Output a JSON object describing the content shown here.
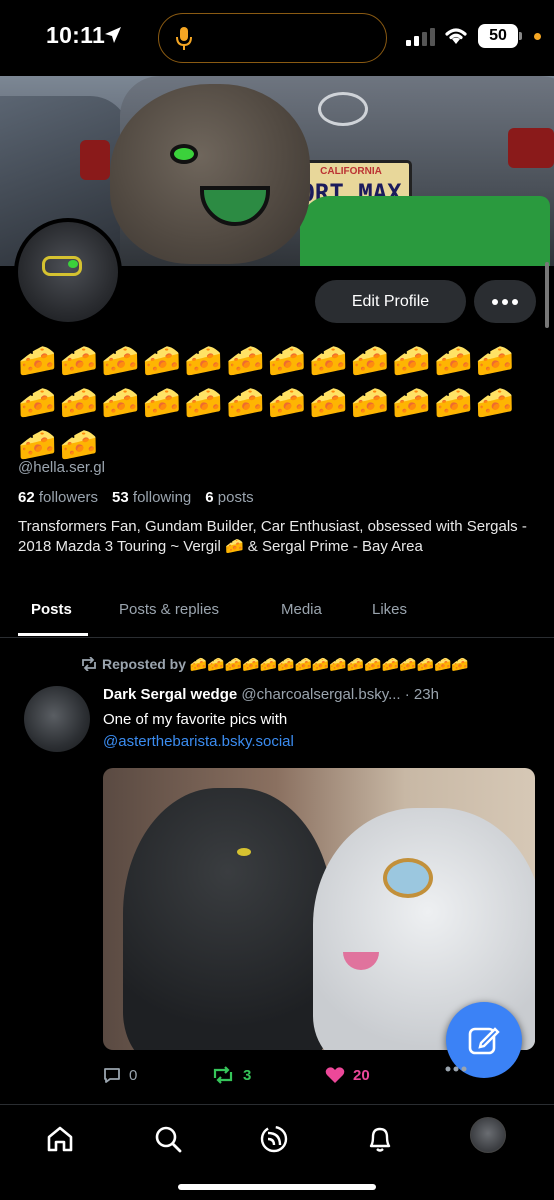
{
  "status_bar": {
    "time": "10:11",
    "battery": "50",
    "icons": [
      "location-arrow-icon",
      "microphone-icon",
      "cellular-signal-icon",
      "wifi-icon",
      "battery-icon"
    ]
  },
  "banner": {
    "plate_state": "CALIFORNIA",
    "plate_text": "ORT MAX"
  },
  "profile": {
    "display_name": "🧀🧀🧀🧀🧀🧀🧀🧀🧀🧀🧀🧀🧀🧀🧀🧀🧀🧀🧀🧀🧀🧀🧀🧀🧀🧀",
    "handle": "@hella.ser.gl",
    "followers_count": "62",
    "followers_label": "followers",
    "following_count": "53",
    "following_label": "following",
    "posts_count": "6",
    "posts_label": "posts",
    "bio": "Transformers Fan, Gundam Builder, Car Enthusiast, obsessed with Sergals - 2018 Mazda 3 Touring ~ Vergil 🧀 & Sergal Prime - Bay Area",
    "edit_label": "Edit Profile"
  },
  "tabs": [
    {
      "label": "Posts",
      "active": true
    },
    {
      "label": "Posts & replies",
      "active": false
    },
    {
      "label": "Media",
      "active": false
    },
    {
      "label": "Likes",
      "active": false
    }
  ],
  "post": {
    "repost_label": "Reposted by 🧀🧀🧀🧀🧀🧀🧀🧀🧀🧀🧀🧀🧀🧀🧀🧀",
    "author": "Dark Sergal wedge",
    "author_handle": "@charcoalsergal.bsky...",
    "time": "· 23h",
    "text": "One of my favorite pics with",
    "link": "@asterthebarista.bsky.social",
    "reply_count": "0",
    "repost_count": "3",
    "like_count": "20"
  },
  "colors": {
    "accent_blue": "#3b82f6",
    "link_blue": "#3b8cf0",
    "repost_green": "#36c55a",
    "like_pink": "#ec4899",
    "muted_text": "#9aa4ae"
  },
  "nav": [
    "home-icon",
    "search-icon",
    "feeds-icon",
    "notifications-icon",
    "profile-avatar"
  ]
}
